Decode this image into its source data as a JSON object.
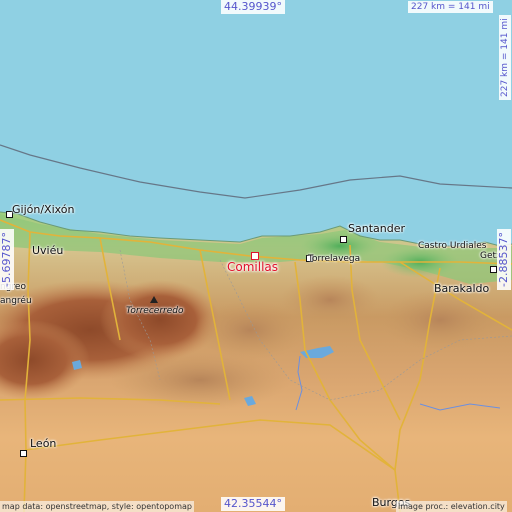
{
  "map": {
    "place": "Comillas",
    "coords": {
      "north": "44.39939°",
      "south": "42.35544°",
      "west": "-5.69787°",
      "east": "-2.88537°"
    },
    "scale": "227 km = 141 mi",
    "attribution_left": "map data: openstreetmap, style: opentopomap",
    "attribution_right": "image proc.: elevation.city",
    "labels": [
      "Gijón/Xixón",
      "Uviéu",
      "Santander",
      "Torrelavega",
      "Castro Urdiales",
      "Getx",
      "Barakaldo",
      "Torrecerredo",
      "León",
      "Burgos"
    ],
    "edge_labels": [
      "ngreo",
      "angréu"
    ],
    "colors": {
      "sea": "#8fd0e3",
      "coast_green": "#7cc47a",
      "highlight": "#e0102a",
      "coord_text": "#5555cc"
    },
    "icons": [
      "city-marker-icon",
      "peak-icon",
      "comillas-marker-icon"
    ]
  }
}
